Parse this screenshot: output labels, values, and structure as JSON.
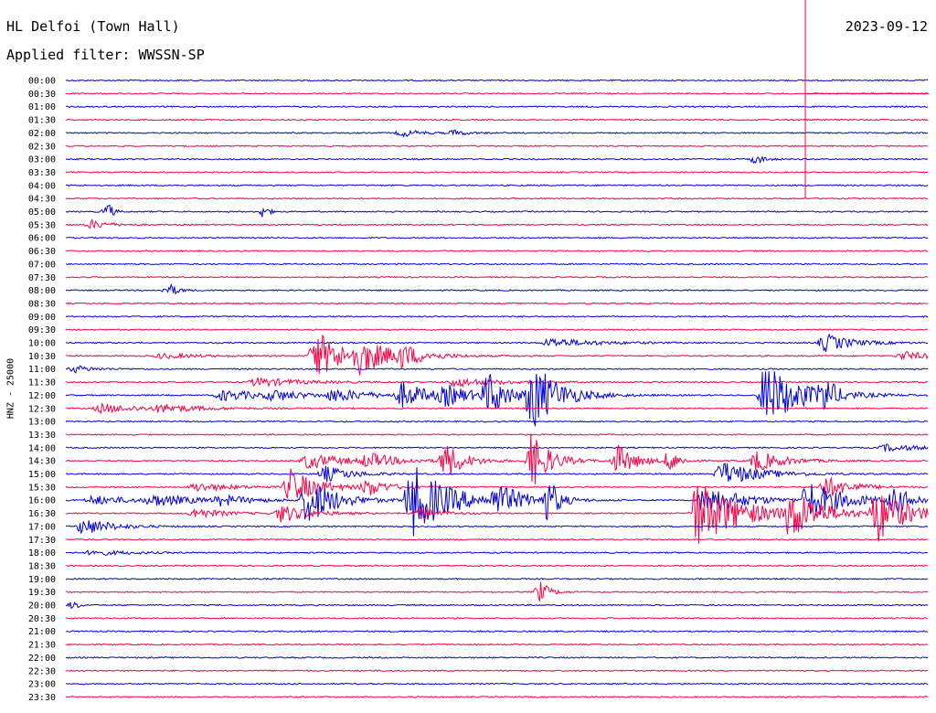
{
  "header": {
    "station": "HL Delfoi (Town Hall)",
    "filter": "Applied filter: WWSSN-SP",
    "date": "2023-09-12"
  },
  "chart_data": {
    "type": "line",
    "ylabel": "HNZ - 25000",
    "row_labels": [
      "00:00",
      "00:30",
      "01:00",
      "01:30",
      "02:00",
      "02:30",
      "03:00",
      "03:30",
      "04:00",
      "04:30",
      "05:00",
      "05:30",
      "06:00",
      "06:30",
      "07:00",
      "07:30",
      "08:00",
      "08:30",
      "09:00",
      "09:30",
      "10:00",
      "10:30",
      "11:00",
      "11:30",
      "12:00",
      "12:30",
      "13:00",
      "13:30",
      "14:00",
      "14:30",
      "15:00",
      "15:30",
      "16:00",
      "16:30",
      "17:00",
      "17:30",
      "18:00",
      "18:30",
      "19:00",
      "19:30",
      "20:00",
      "20:30",
      "21:00",
      "21:30",
      "22:00",
      "22:30",
      "23:00",
      "23:30"
    ],
    "colors": {
      "even": "#0000dd",
      "odd": "#ff0044"
    },
    "time_marker_row": 1,
    "time_marker_fraction": 0.857,
    "events": [
      {
        "row": 4,
        "t": 0.39,
        "a": 4,
        "d": 0.02
      },
      {
        "row": 4,
        "t": 0.45,
        "a": 3,
        "d": 0.015
      },
      {
        "row": 6,
        "t": 0.8,
        "a": 5,
        "d": 0.01
      },
      {
        "row": 10,
        "t": 0.05,
        "a": 10,
        "d": 0.005
      },
      {
        "row": 10,
        "t": 0.23,
        "a": 8,
        "d": 0.005
      },
      {
        "row": 11,
        "t": 0.03,
        "a": 5,
        "d": 0.02
      },
      {
        "row": 16,
        "t": 0.12,
        "a": 7,
        "d": 0.01
      },
      {
        "row": 20,
        "t": 0.88,
        "a": 10,
        "d": 0.03
      },
      {
        "row": 20,
        "t": 0.56,
        "a": 5,
        "d": 0.05
      },
      {
        "row": 21,
        "t": 0.29,
        "a": 28,
        "d": 0.03
      },
      {
        "row": 21,
        "t": 0.34,
        "a": 16,
        "d": 0.04
      },
      {
        "row": 21,
        "t": 0.39,
        "a": 9,
        "d": 0.02
      },
      {
        "row": 21,
        "t": 0.11,
        "a": 3,
        "d": 0.04
      },
      {
        "row": 21,
        "t": 0.97,
        "a": 5,
        "d": 0.03
      },
      {
        "row": 22,
        "t": 0.01,
        "a": 4,
        "d": 0.02
      },
      {
        "row": 23,
        "t": 0.22,
        "a": 5,
        "d": 0.05
      },
      {
        "row": 23,
        "t": 0.45,
        "a": 5,
        "d": 0.05
      },
      {
        "row": 24,
        "t": 0.39,
        "a": 14,
        "d": 0.03
      },
      {
        "row": 24,
        "t": 0.44,
        "a": 10,
        "d": 0.03
      },
      {
        "row": 24,
        "t": 0.49,
        "a": 24,
        "d": 0.02
      },
      {
        "row": 24,
        "t": 0.54,
        "a": 38,
        "d": 0.03
      },
      {
        "row": 24,
        "t": 0.81,
        "a": 36,
        "d": 0.04
      },
      {
        "row": 24,
        "t": 0.88,
        "a": 18,
        "d": 0.01
      },
      {
        "row": 24,
        "t": 0.18,
        "a": 6,
        "d": 0.05
      },
      {
        "row": 24,
        "t": 0.24,
        "a": 5,
        "d": 0.03
      },
      {
        "row": 24,
        "t": 0.31,
        "a": 7,
        "d": 0.04
      },
      {
        "row": 25,
        "t": 0.04,
        "a": 5,
        "d": 0.05
      },
      {
        "row": 25,
        "t": 0.11,
        "a": 4,
        "d": 0.04
      },
      {
        "row": 28,
        "t": 0.95,
        "a": 4,
        "d": 0.04
      },
      {
        "row": 29,
        "t": 0.28,
        "a": 9,
        "d": 0.04
      },
      {
        "row": 29,
        "t": 0.35,
        "a": 8,
        "d": 0.03
      },
      {
        "row": 29,
        "t": 0.44,
        "a": 20,
        "d": 0.02
      },
      {
        "row": 29,
        "t": 0.54,
        "a": 32,
        "d": 0.02
      },
      {
        "row": 29,
        "t": 0.64,
        "a": 18,
        "d": 0.02
      },
      {
        "row": 29,
        "t": 0.7,
        "a": 12,
        "d": 0.01
      },
      {
        "row": 29,
        "t": 0.8,
        "a": 12,
        "d": 0.03
      },
      {
        "row": 30,
        "t": 0.76,
        "a": 14,
        "d": 0.04
      },
      {
        "row": 30,
        "t": 0.3,
        "a": 9,
        "d": 0.03
      },
      {
        "row": 31,
        "t": 0.26,
        "a": 20,
        "d": 0.03
      },
      {
        "row": 31,
        "t": 0.35,
        "a": 10,
        "d": 0.02
      },
      {
        "row": 31,
        "t": 0.15,
        "a": 5,
        "d": 0.04
      },
      {
        "row": 31,
        "t": 0.88,
        "a": 12,
        "d": 0.03
      },
      {
        "row": 32,
        "t": 0.28,
        "a": 28,
        "d": 0.03
      },
      {
        "row": 32,
        "t": 0.4,
        "a": 42,
        "d": 0.04
      },
      {
        "row": 32,
        "t": 0.5,
        "a": 16,
        "d": 0.03
      },
      {
        "row": 32,
        "t": 0.56,
        "a": 25,
        "d": 0.01
      },
      {
        "row": 32,
        "t": 0.74,
        "a": 18,
        "d": 0.04
      },
      {
        "row": 32,
        "t": 0.86,
        "a": 22,
        "d": 0.04
      },
      {
        "row": 32,
        "t": 0.96,
        "a": 14,
        "d": 0.02
      },
      {
        "row": 32,
        "t": 0.03,
        "a": 5,
        "d": 0.05
      },
      {
        "row": 32,
        "t": 0.1,
        "a": 6,
        "d": 0.05
      },
      {
        "row": 32,
        "t": 0.18,
        "a": 5,
        "d": 0.03
      },
      {
        "row": 33,
        "t": 0.73,
        "a": 38,
        "d": 0.05
      },
      {
        "row": 33,
        "t": 0.84,
        "a": 28,
        "d": 0.03
      },
      {
        "row": 33,
        "t": 0.94,
        "a": 32,
        "d": 0.03
      },
      {
        "row": 33,
        "t": 0.25,
        "a": 10,
        "d": 0.03
      },
      {
        "row": 33,
        "t": 0.15,
        "a": 6,
        "d": 0.03
      },
      {
        "row": 33,
        "t": 0.41,
        "a": 8,
        "d": 0.02
      },
      {
        "row": 34,
        "t": 0.02,
        "a": 10,
        "d": 0.03
      },
      {
        "row": 36,
        "t": 0.03,
        "a": 3,
        "d": 0.04
      },
      {
        "row": 39,
        "t": 0.55,
        "a": 12,
        "d": 0.01
      },
      {
        "row": 40,
        "t": 0.01,
        "a": 5,
        "d": 0.005
      }
    ]
  }
}
